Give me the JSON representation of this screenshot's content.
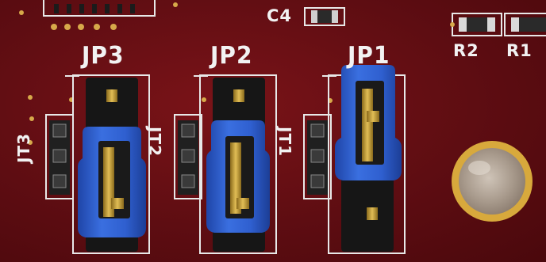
{
  "board": {
    "colors": {
      "pcb": "#6a1016",
      "silkscreen": "#f2f2f2",
      "jumper_cap": "#2f5fcf",
      "header_body": "#1a1a1a",
      "pin_gold": "#c9a23a",
      "pad_gold": "#d8a93c"
    },
    "jumpers": [
      {
        "label": "JP3",
        "tag": "JT3"
      },
      {
        "label": "JP2",
        "tag": "JT2"
      },
      {
        "label": "JP1",
        "tag": "JT1"
      }
    ],
    "caps": {
      "c4": "C4"
    },
    "resistors": {
      "r2": "R2",
      "r1": "R1"
    }
  }
}
